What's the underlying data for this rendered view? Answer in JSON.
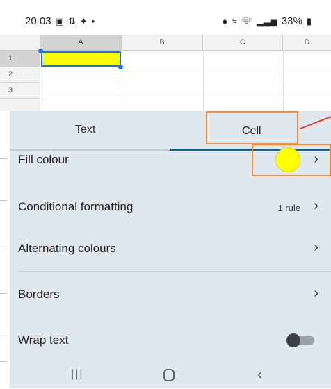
{
  "status_bar": {
    "time": "20:03",
    "left_icons": [
      "gallery-icon",
      "signal-activity-icon",
      "twitter-icon",
      "dot-icon"
    ],
    "right_icons": [
      "location-icon",
      "wifi-icon",
      "call-wifi-icon",
      "signal-bars-icon"
    ],
    "battery": "33%"
  },
  "sheet": {
    "columns": [
      "A",
      "B",
      "C",
      "D"
    ],
    "rows": [
      "1",
      "2",
      "3"
    ],
    "selected_cell": "A1",
    "selected_cell_fill": "#ffff00"
  },
  "panel": {
    "tabs": [
      {
        "label": "Text",
        "active": false
      },
      {
        "label": "Cell",
        "active": true
      }
    ],
    "rows": {
      "fill_colour": {
        "label": "Fill colour",
        "swatch_color": "#ffff00"
      },
      "conditional_formatting": {
        "label": "Conditional formatting",
        "value": "1 rule"
      },
      "alternating_colours": {
        "label": "Alternating colours"
      },
      "borders": {
        "label": "Borders"
      },
      "wrap_text": {
        "label": "Wrap text",
        "enabled": false
      }
    }
  },
  "nav_bar": {
    "icons": [
      "recents-icon",
      "home-icon",
      "back-icon"
    ]
  },
  "colors": {
    "panel_bg": "#dfe7ef",
    "active_tab_underline": "#1b5e80",
    "annotation_box": "#f08a3c",
    "annotation_arrow": "#e53935"
  }
}
